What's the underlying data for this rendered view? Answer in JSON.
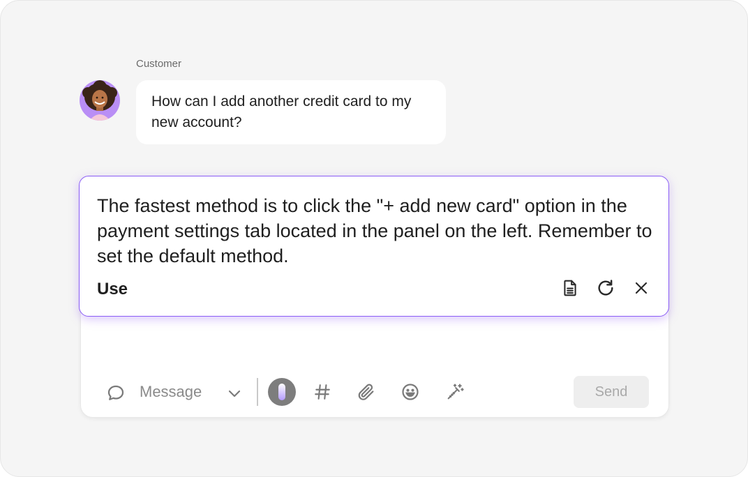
{
  "conversation": {
    "sender_label": "Customer",
    "customer_message": "How can I add another credit card to my new account?"
  },
  "suggestion": {
    "text": "The fastest method is to click the \"+ add new card\" option in the payment settings tab located in the panel on the left. Remember to set the default method.",
    "use_label": "Use",
    "actions": [
      "document-icon",
      "refresh-icon",
      "close-icon"
    ]
  },
  "composer": {
    "mode_label": "Message",
    "send_label": "Send",
    "toolbar_icons": [
      "chat-bubble-icon",
      "chevron-down-icon",
      "ai-toggle-icon",
      "hash-icon",
      "paperclip-icon",
      "emoji-icon",
      "magic-wand-icon"
    ]
  },
  "colors": {
    "accent": "#8a5cf5",
    "background": "#f5f5f5",
    "send_disabled": "#eeeeee"
  }
}
